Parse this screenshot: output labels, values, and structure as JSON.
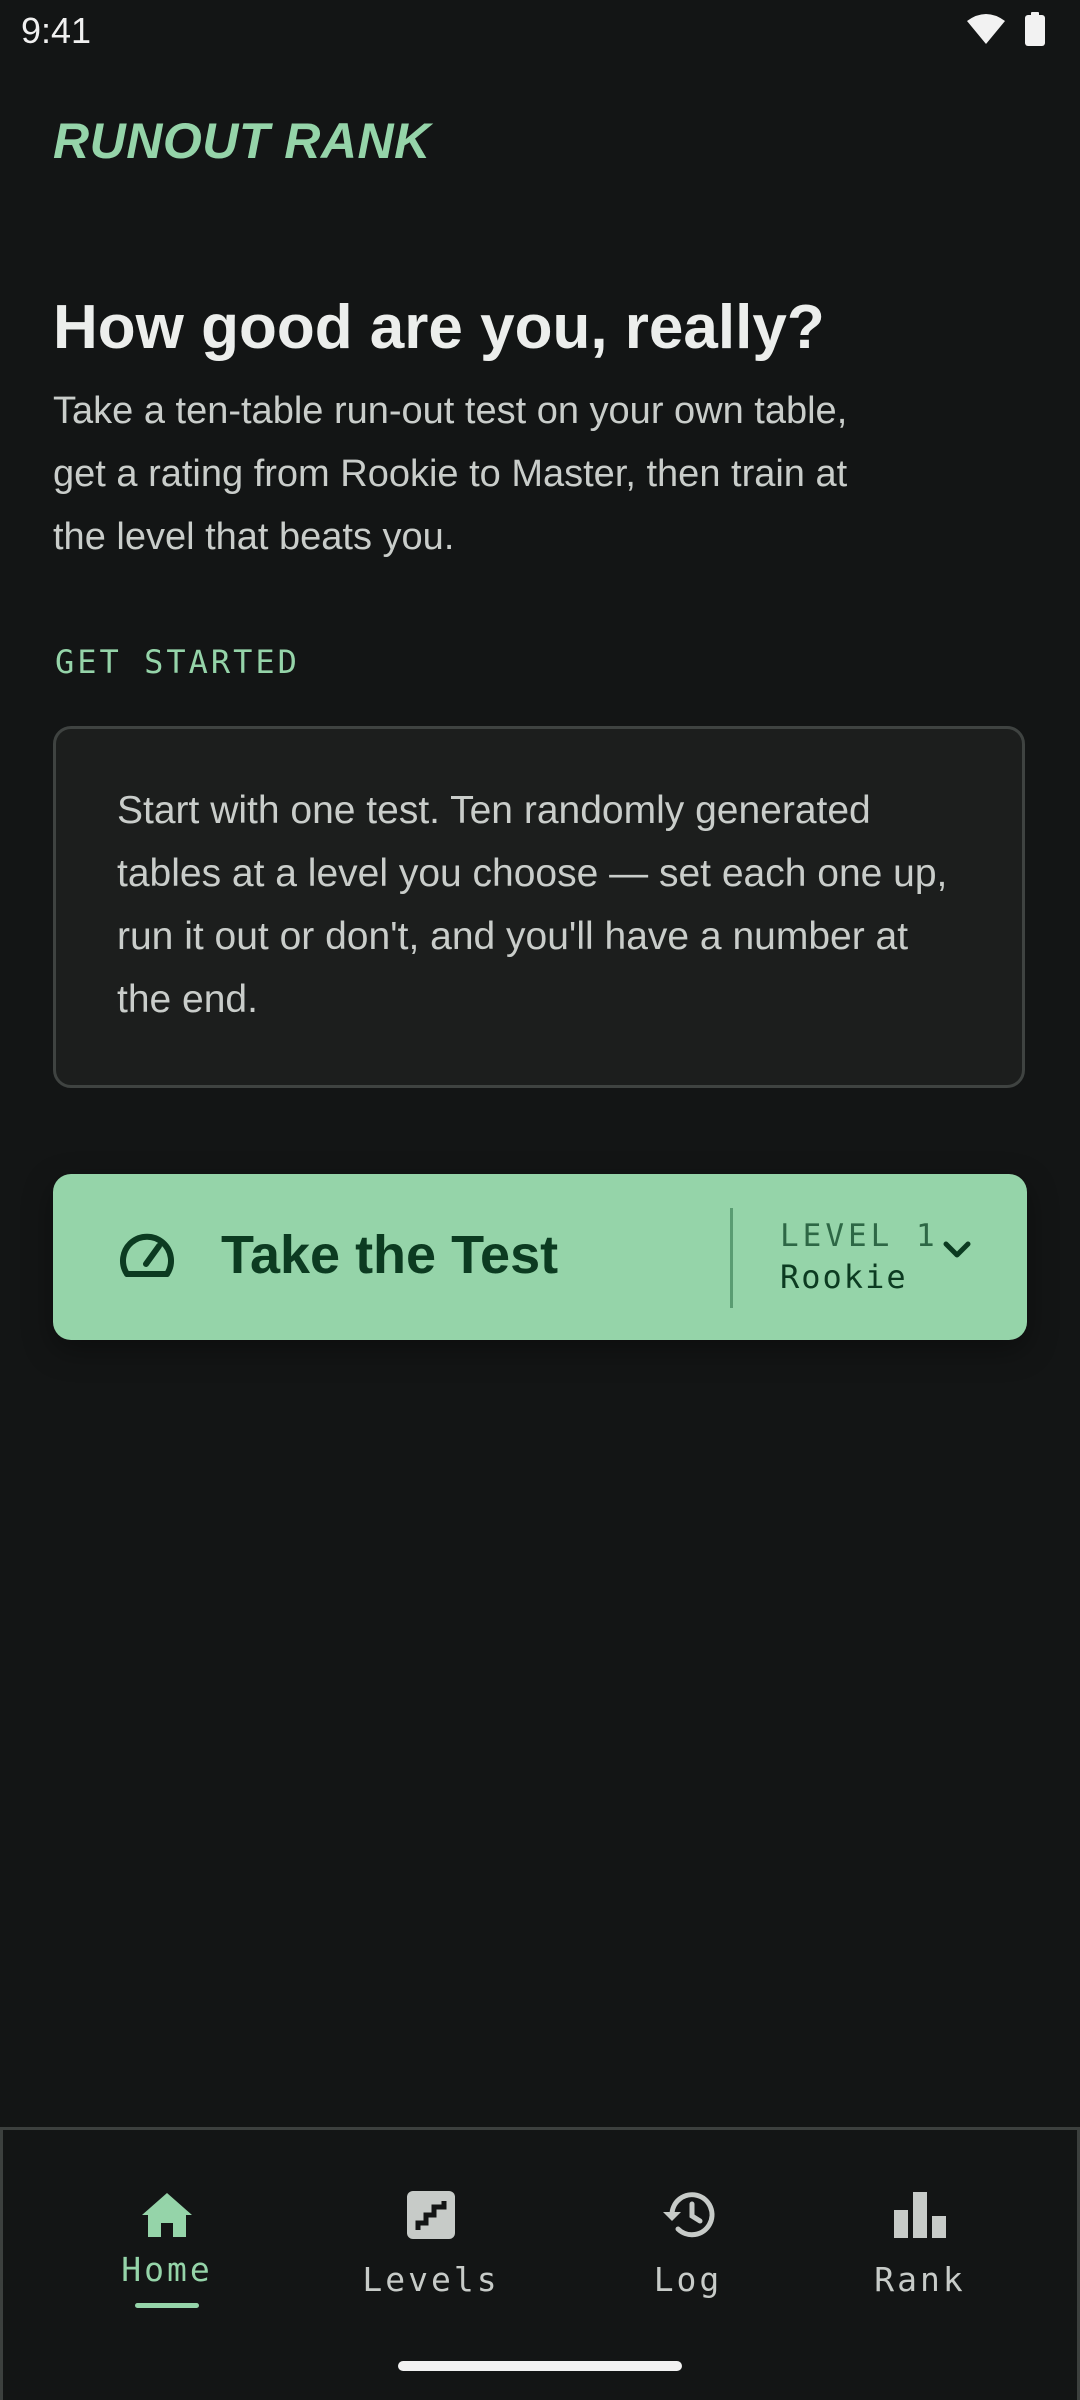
{
  "status": {
    "time": "9:41",
    "wifi_icon": "wifi-icon",
    "battery_icon": "battery-icon"
  },
  "app": {
    "title": "RUNOUT RANK"
  },
  "hero": {
    "headline": "How good are you, really?",
    "intro": "Take a ten-table run-out test on your own table, get a rating from Rookie to Master, then train at the level that beats you."
  },
  "get_started": {
    "label": "GET STARTED",
    "card_text": "Start with one test. Ten randomly generated tables at a level you choose — set each one up, run it out or don't, and you'll have a number at the end."
  },
  "cta": {
    "label": "Take the Test",
    "icon": "speedometer-icon",
    "level_number": "LEVEL 1",
    "level_name": "Rookie",
    "chevron_icon": "chevron-down-icon"
  },
  "nav": {
    "items": [
      {
        "label": "Home",
        "icon": "home-icon",
        "active": true
      },
      {
        "label": "Levels",
        "icon": "stairs-icon",
        "active": false
      },
      {
        "label": "Log",
        "icon": "history-icon",
        "active": false
      },
      {
        "label": "Rank",
        "icon": "bar-chart-icon",
        "active": false
      }
    ]
  },
  "colors": {
    "background": "#131515",
    "accent": "#95d4a9",
    "accent_dark_text": "#0c3b21",
    "card_border": "#3f4341"
  }
}
